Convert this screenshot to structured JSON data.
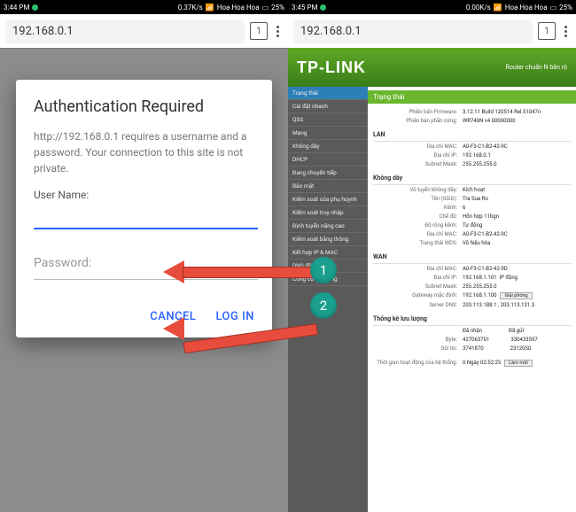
{
  "left": {
    "status": {
      "time": "3:44 PM",
      "speed": "0.37K/s",
      "net": "Hoa Hoa Hoa",
      "batt": "25%"
    },
    "url": "192.168.0.1",
    "tab_count": "1",
    "dialog": {
      "title": "Authentication Required",
      "message": "http://192.168.0.1 requires a username and a password. Your connection to this site is not private.",
      "user_label": "User Name:",
      "password_placeholder": "Password:",
      "cancel": "CANCEL",
      "login": "LOG IN"
    }
  },
  "right": {
    "status": {
      "time": "3:45 PM",
      "speed": "0.00K/s",
      "net": "Hoa Hoa Hoa",
      "batt": "25%"
    },
    "url": "192.168.0.1",
    "tab_count": "1",
    "brand": "TP-LINK",
    "brand_sub": "Router chuẩn N băn rộ",
    "menu": [
      "Trạng thái",
      "Cài đặt nhanh",
      "QSS",
      "Mạng",
      "Không dây",
      "DHCP",
      "Đang chuyển tiếp",
      "Bảo mật",
      "Kiểm soát của phụ huynh",
      "Kiểm soát truy nhập",
      "Định tuyến nâng cao",
      "Kiểm soát băng thông",
      "Kết hợp IP & MAC",
      "DNS động",
      "Công cụ hệ thống"
    ],
    "page_title": "Trạng thái",
    "firmware_k": "Phiên bản Firmware:",
    "firmware_v": "3.12.11 Build 120514 Rel.51047n",
    "hardware_k": "Phiên bản phần cứng:",
    "hardware_v": "WR740N v4 00000000",
    "lan": "LAN",
    "lan_mac_k": "Địa chỉ MAC:",
    "lan_mac_v": "A0-F3-C1-B2-42-9C",
    "lan_ip_k": "Địa chỉ IP:",
    "lan_ip_v": "192.168.0.1",
    "lan_mask_k": "Subnet Mask:",
    "lan_mask_v": "255.255.255.0",
    "wlan": "Không dây",
    "wlan_state_k": "Vô tuyến không dây:",
    "wlan_state_v": "Kích hoạt",
    "wlan_ssid_k": "Tên (SSID):",
    "wlan_ssid_v": "Tra Sua Ro",
    "wlan_ch_k": "Kênh:",
    "wlan_ch_v": "6",
    "wlan_mode_k": "Chế độ:",
    "wlan_mode_v": "Hỗn hợp 11bgn",
    "wlan_width_k": "Độ rộng kênh:",
    "wlan_width_v": "Tự động",
    "wlan_mac_k": "Địa chỉ MAC:",
    "wlan_mac_v": "A0-F3-C1-B2-42-9C",
    "wlan_wds_k": "Trạng thái WDS:",
    "wlan_wds_v": "Vô hiệu hóa",
    "wan": "WAN",
    "wan_mac_k": "Địa chỉ MAC:",
    "wan_mac_v": "A0-F3-C1-B2-42-9D",
    "wan_ip_k": "Địa chỉ IP:",
    "wan_ip_v": "192.168.1.101",
    "wan_ip_type": "IP động",
    "wan_mask_k": "Subnet Mask:",
    "wan_mask_v": "255.255.255.0",
    "wan_gw_k": "Gateway mặc định:",
    "wan_gw_v": "192.168.1.100",
    "release_btn": "Giải phóng",
    "wan_dns_k": "Server DNS:",
    "wan_dns_v": "203.113.188.1 , 203.113.131.3",
    "traffic": "Thống kê lưu lượng",
    "rx": "Đã nhận",
    "tx": "Đã gửi",
    "bytes_k": "Byte:",
    "bytes_rx": "427063701",
    "bytes_tx": "330433597",
    "pkts_k": "Gói tin:",
    "pkts_rx": "3741870",
    "pkts_tx": "2312050",
    "uptime_k": "Thời gian hoạt động của hệ thống:",
    "uptime_v": "0 Ngày 02:52:25",
    "refresh_btn": "Làm mới"
  },
  "markers": {
    "one": "1",
    "two": "2"
  }
}
